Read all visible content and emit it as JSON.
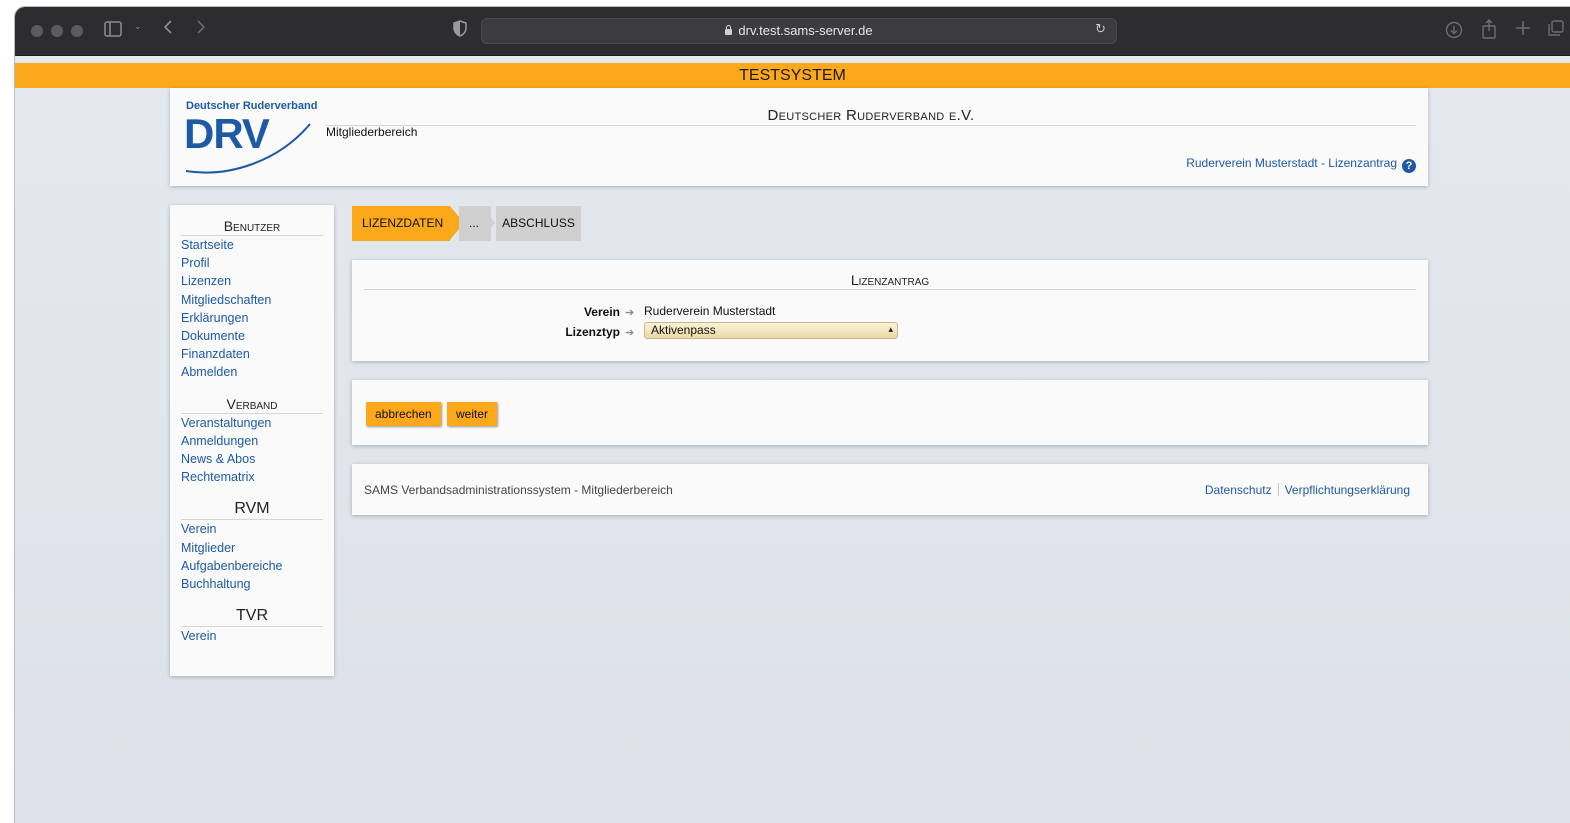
{
  "browser": {
    "url": "drv.test.sams-server.de"
  },
  "banner": "TESTSYSTEM",
  "header": {
    "logo_small": "Deutscher Ruderverband",
    "logo_big": "DRV",
    "member_area": "Mitgliederbereich",
    "org_title": "Deutscher Ruderverband e.V.",
    "context_link": "Ruderverein Musterstadt - Lizenzantrag"
  },
  "sidebar": {
    "sections": [
      {
        "title": "Benutzer",
        "items": [
          "Startseite",
          "Profil",
          "Lizenzen",
          "Mitgliedschaften",
          "Erklärungen",
          "Dokumente",
          "Finanzdaten",
          "Abmelden"
        ]
      },
      {
        "title": "Verband",
        "items": [
          "Veranstaltungen",
          "Anmeldungen",
          "News & Abos",
          "Rechtematrix"
        ]
      },
      {
        "title": "RVM",
        "items": [
          "Verein",
          "Mitglieder",
          "Aufgabenbereiche",
          "Buchhaltung"
        ]
      },
      {
        "title": "TVR",
        "items": [
          "Verein"
        ]
      }
    ]
  },
  "steps": [
    "LIZENZDATEN",
    "...",
    "ABSCHLUSS"
  ],
  "form": {
    "title": "Lizenzantrag",
    "verein_label": "Verein",
    "verein_value": "Ruderverein Musterstadt",
    "lizenztyp_label": "Lizenztyp",
    "lizenztyp_value": "Aktivenpass"
  },
  "actions": {
    "cancel": "abbrechen",
    "next": "weiter"
  },
  "footer": {
    "text": "SAMS Verbandsadministrationssystem - Mitgliederbereich",
    "link_privacy": "Datenschutz",
    "link_commitment": "Verpflichtungserklärung"
  },
  "colors": {
    "accent": "#fca81b",
    "link": "#1d5aa6"
  }
}
